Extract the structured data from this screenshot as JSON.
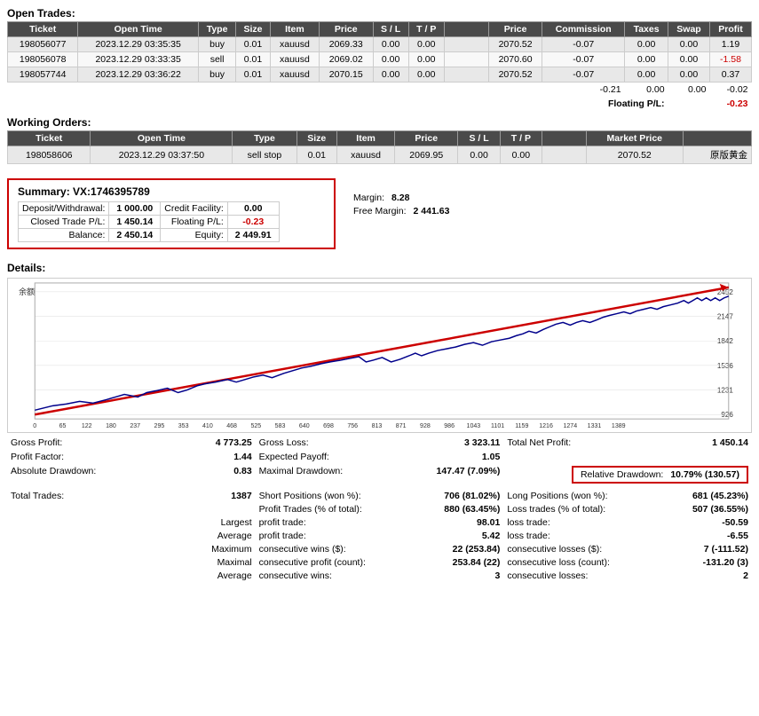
{
  "openTrades": {
    "title": "Open Trades:",
    "headers": [
      "Ticket",
      "Open Time",
      "Type",
      "Size",
      "Item",
      "Price",
      "S / L",
      "T / P",
      "",
      "Price",
      "Commission",
      "Taxes",
      "Swap",
      "Profit"
    ],
    "rows": [
      {
        "ticket": "198056077",
        "openTime": "2023.12.29 03:35:35",
        "type": "buy",
        "size": "0.01",
        "item": "xauusd",
        "price": "2069.33",
        "sl": "0.00",
        "tp": "0.00",
        "price2": "2070.52",
        "commission": "-0.07",
        "taxes": "0.00",
        "swap": "0.00",
        "profit": "1.19"
      },
      {
        "ticket": "198056078",
        "openTime": "2023.12.29 03:33:35",
        "type": "sell",
        "size": "0.01",
        "item": "xauusd",
        "price": "2069.02",
        "sl": "0.00",
        "tp": "0.00",
        "price2": "2070.60",
        "commission": "-0.07",
        "taxes": "0.00",
        "swap": "0.00",
        "profit": "-1.58"
      },
      {
        "ticket": "198057744",
        "openTime": "2023.12.29 03:36:22",
        "type": "buy",
        "size": "0.01",
        "item": "xauusd",
        "price": "2070.15",
        "sl": "0.00",
        "tp": "0.00",
        "price2": "2070.52",
        "commission": "-0.07",
        "taxes": "0.00",
        "swap": "0.00",
        "profit": "0.37"
      }
    ],
    "totals": {
      "commission": "-0.21",
      "taxes": "0.00",
      "swap": "0.00",
      "profit": "-0.02"
    },
    "floating": {
      "label": "Floating P/L:",
      "value": "-0.23"
    }
  },
  "workingOrders": {
    "title": "Working Orders:",
    "headers": [
      "Ticket",
      "Open Time",
      "Type",
      "Size",
      "Item",
      "Price",
      "S / L",
      "T / P",
      "",
      "Market Price",
      "",
      ""
    ],
    "rows": [
      {
        "ticket": "198058606",
        "openTime": "2023.12.29 03:37:50",
        "type": "sell stop",
        "size": "0.01",
        "item": "xauusd",
        "price": "2069.95",
        "sl": "0.00",
        "tp": "0.00",
        "marketPrice": "2070.52",
        "note": "原版黄金"
      }
    ]
  },
  "summary": {
    "title": "Summary:",
    "id": "VX:1746395789",
    "depositWithdrawal": {
      "label": "Deposit/Withdrawal:",
      "value": "1 000.00"
    },
    "closedTradePL": {
      "label": "Closed Trade P/L:",
      "value": "1 450.14"
    },
    "balance": {
      "label": "Balance:",
      "value": "2 450.14"
    },
    "creditFacility": {
      "label": "Credit Facility:",
      "value": "0.00"
    },
    "floatingPL": {
      "label": "Floating P/L:",
      "value": "-0.23"
    },
    "equity": {
      "label": "Equity:",
      "value": "2 449.91"
    },
    "margin": {
      "label": "Margin:",
      "value": "8.28"
    },
    "freeMargin": {
      "label": "Free Margin:",
      "value": "2 441.63"
    }
  },
  "details": {
    "title": "Details:",
    "chartYLabels": [
      "2452",
      "2147",
      "1842",
      "1536",
      "1231",
      "926"
    ],
    "chartXLabels": [
      "0",
      "65",
      "122",
      "180",
      "237",
      "295",
      "353",
      "410",
      "468",
      "525",
      "583",
      "640",
      "698",
      "756",
      "813",
      "871",
      "928",
      "986",
      "1043",
      "1101",
      "1159",
      "1216",
      "1274",
      "1331",
      "1389"
    ],
    "chartYAxisLabel": "余额",
    "stats": {
      "grossProfit": {
        "label": "Gross Profit:",
        "value": "4 773.25"
      },
      "grossLoss": {
        "label": "Gross Loss:",
        "value": "3 323.11"
      },
      "totalNetProfit": {
        "label": "Total Net Profit:",
        "value": "1 450.14"
      },
      "profitFactor": {
        "label": "Profit Factor:",
        "value": "1.44"
      },
      "expectedPayoff": {
        "label": "Expected Payoff:",
        "value": "1.05"
      },
      "absoluteDrawdown": {
        "label": "Absolute Drawdown:",
        "value": "0.83"
      },
      "maximalDrawdown": {
        "label": "Maximal Drawdown:",
        "value": "147.47 (7.09%)"
      },
      "relativeDrawdown": {
        "label": "Relative Drawdown:",
        "value": "10.79% (130.57)"
      }
    },
    "trades": {
      "totalTrades": {
        "label": "Total Trades:",
        "value": "1387"
      },
      "shortPositions": {
        "label": "Short Positions (won %):",
        "value": "706 (81.02%)"
      },
      "longPositions": {
        "label": "Long Positions (won %):",
        "value": "681 (45.23%)"
      },
      "profitTrades": {
        "label": "Profit Trades (% of total):",
        "value": "880 (63.45%)"
      },
      "lossTrades": {
        "label": "Loss trades (% of total):",
        "value": "507 (36.55%)"
      },
      "largestProfitTrade": {
        "label": "profit trade:",
        "labelPrefix": "Largest",
        "value": "98.01"
      },
      "largestLossTrade": {
        "label": "loss trade:",
        "value": "-50.59"
      },
      "averageProfitTrade": {
        "label": "profit trade:",
        "labelPrefix": "Average",
        "value": "5.42"
      },
      "averageLossTrade": {
        "label": "loss trade:",
        "value": "-6.55"
      },
      "maxConsecutiveWins": {
        "label": "consecutive wins ($):",
        "labelPrefix": "Maximum",
        "value": "22 (253.84)"
      },
      "maxConsecutiveLosses": {
        "label": "consecutive losses ($):",
        "value": "7 (-111.52)"
      },
      "maximalConsecutiveProfit": {
        "label": "consecutive profit (count):",
        "labelPrefix": "Maximal",
        "value": "253.84 (22)"
      },
      "maximalConsecutiveLoss": {
        "label": "consecutive loss (count):",
        "value": "-131.20 (3)"
      },
      "averageConsecutiveWins": {
        "label": "consecutive wins:",
        "labelPrefix": "Average",
        "value": "3"
      },
      "averageConsecutiveLosses": {
        "label": "consecutive losses:",
        "value": "2"
      }
    }
  },
  "colors": {
    "headerBg": "#4a4a4a",
    "headerText": "#ffffff",
    "rowEven": "#e8e8e8",
    "rowOdd": "#f8f8f8",
    "negative": "#cc0000",
    "redBorder": "#cc0000",
    "chartLine": "#00008b",
    "trendLine": "#cc0000",
    "accent": "#000080"
  }
}
